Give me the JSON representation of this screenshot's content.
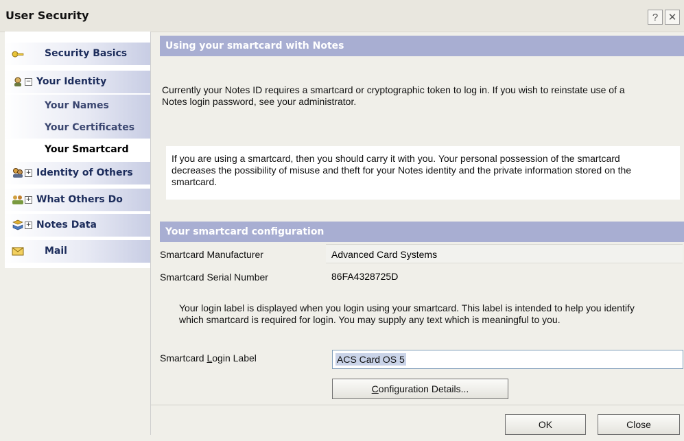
{
  "window": {
    "title": "User Security",
    "help_glyph": "?",
    "close_glyph": "✕"
  },
  "nav": {
    "items": [
      {
        "label": "Security Basics",
        "icon": "key-icon"
      },
      {
        "label": "Your Identity",
        "icon": "identity-icon",
        "tree": "⊟"
      },
      {
        "label": "Your Names"
      },
      {
        "label": "Your Certificates"
      },
      {
        "label": "Your Smartcard",
        "selected": true
      },
      {
        "label": "Identity of Others",
        "icon": "people-icon",
        "tree": "⊞"
      },
      {
        "label": "What Others Do",
        "icon": "group-icon",
        "tree": "⊞"
      },
      {
        "label": "Notes Data",
        "icon": "data-icon",
        "tree": "⊞"
      },
      {
        "label": "Mail",
        "icon": "mail-icon"
      }
    ]
  },
  "main": {
    "section1_title": "Using your smartcard with Notes",
    "intro_line1": "Currently your Notes ID requires a smartcard or cryptographic token to log in.  If you wish to reinstate use of a",
    "intro_line2": "Notes login password, see your administrator.",
    "info_line1": "If you are using a smartcard, then you should carry it with you.  Your personal possession of the smartcard",
    "info_line2": "decreases the possibility of misuse and theft for your Notes identity and the private information stored on the",
    "info_line3": "smartcard.",
    "section2_title": "Your smartcard configuration",
    "manufacturer_label": "Smartcard Manufacturer",
    "manufacturer_value": "Advanced Card Systems",
    "serial_label": "Smartcard Serial Number",
    "serial_value": "86FA4328725D",
    "login_help_line1": "Your login label is displayed when you login using your smartcard.  This label is intended to help you identify",
    "login_help_line2": "which smartcard is required for login.  You may supply any text which is meaningful to you.",
    "login_label_pre": "Smartcard ",
    "login_label_ul": "L",
    "login_label_post": "ogin Label",
    "login_label_value": "ACS Card OS 5",
    "config_btn_ul": "C",
    "config_btn_rest": "onfiguration Details..."
  },
  "footer": {
    "ok_label": "OK",
    "close_label": "Close"
  }
}
